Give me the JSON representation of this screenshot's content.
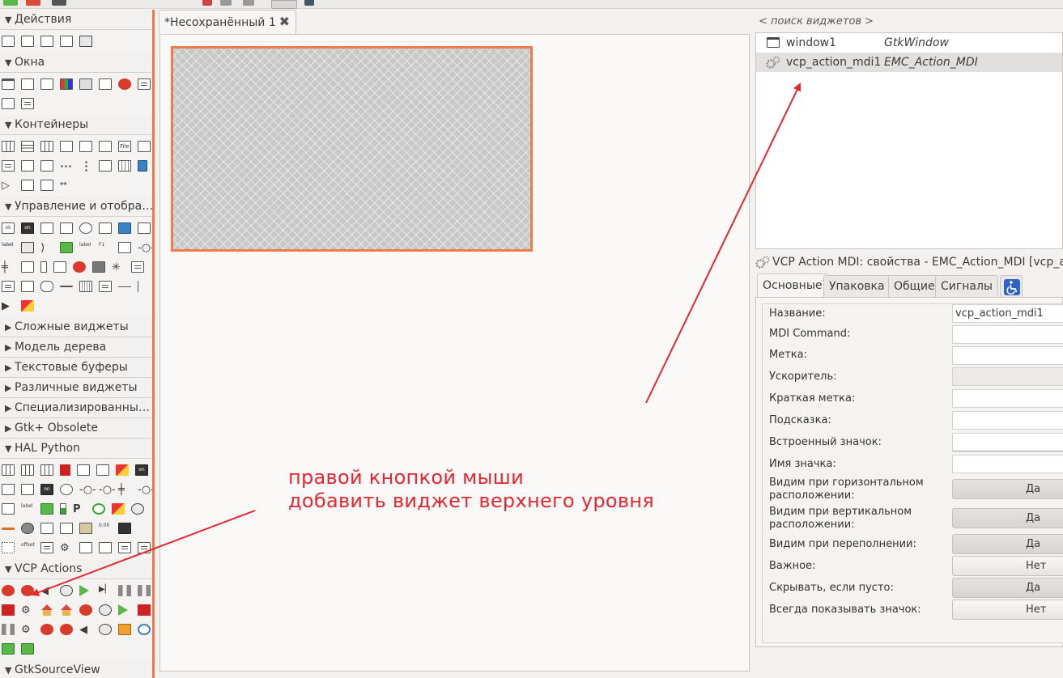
{
  "palette": {
    "sections": [
      {
        "label": "Действия",
        "expanded": true
      },
      {
        "label": "Окна",
        "expanded": true
      },
      {
        "label": "Контейнеры",
        "expanded": true
      },
      {
        "label": "Управление и отобра…",
        "expanded": true
      },
      {
        "label": "Сложные виджеты",
        "expanded": false
      },
      {
        "label": "Модель дерева",
        "expanded": false
      },
      {
        "label": "Текстовые буферы",
        "expanded": false
      },
      {
        "label": "Различные виджеты",
        "expanded": false
      },
      {
        "label": "Специализированны…",
        "expanded": false
      },
      {
        "label": "Gtk+ Obsolete",
        "expanded": false
      },
      {
        "label": "HAL Python",
        "expanded": true
      },
      {
        "label": "VCP Actions",
        "expanded": true
      },
      {
        "label": "GtkSourceView",
        "expanded": true
      }
    ],
    "icon_texts": {
      "ok": "ok",
      "on": "on",
      "label": "label",
      "file": "File",
      "f1": "F1",
      "offset": "offset",
      "num": "0.00"
    }
  },
  "editor": {
    "tab_label": "*Несохранённый 1",
    "close_glyph": "✖"
  },
  "annotation": {
    "line1": "правой кнопкой мыши",
    "line2": "добавить виджет верхнего уровня",
    "color": "#e8262f"
  },
  "inspector": {
    "search_placeholder": "< поиск виджетов >",
    "rows": [
      {
        "name": "window1",
        "type": "GtkWindow",
        "icon": "window-icon"
      },
      {
        "name": "vcp_action_mdi1",
        "type": "EMC_Action_MDI",
        "icon": "gears-icon",
        "selected": true
      }
    ]
  },
  "properties": {
    "title": "VCP Action MDI: свойства - EMC_Action_MDI [vcp_act",
    "tabs": [
      "Основные",
      "Упаковка",
      "Общие",
      "Сигналы"
    ],
    "active_tab": "Основные",
    "rows": [
      {
        "label": "Название:",
        "value": "vcp_action_mdi1",
        "kind": "entry"
      },
      {
        "label": "MDI Command:",
        "value": "",
        "kind": "entry"
      },
      {
        "label": "Метка:",
        "value": "",
        "kind": "entry"
      },
      {
        "label": "Ускоритель:",
        "value": "",
        "kind": "disabled"
      },
      {
        "label": "Краткая метка:",
        "value": "",
        "kind": "entry"
      },
      {
        "label": "Подсказка:",
        "value": "",
        "kind": "entry"
      },
      {
        "label": "Встроенный значок:",
        "value": "",
        "kind": "combo"
      },
      {
        "label": "Имя значка:",
        "value": "",
        "kind": "entry"
      },
      {
        "label": "Видим при горизонтальном расположении:",
        "value": "Да",
        "kind": "toggle"
      },
      {
        "label": "Видим при вертикальном расположении:",
        "value": "Да",
        "kind": "toggle"
      },
      {
        "label": "Видим при переполнении:",
        "value": "Да",
        "kind": "toggle"
      },
      {
        "label": "Важное:",
        "value": "Нет",
        "kind": "toggle"
      },
      {
        "label": "Скрывать, если пусто:",
        "value": "Да",
        "kind": "toggle"
      },
      {
        "label": "Всегда показывать значок:",
        "value": "Нет",
        "kind": "toggle"
      }
    ]
  }
}
